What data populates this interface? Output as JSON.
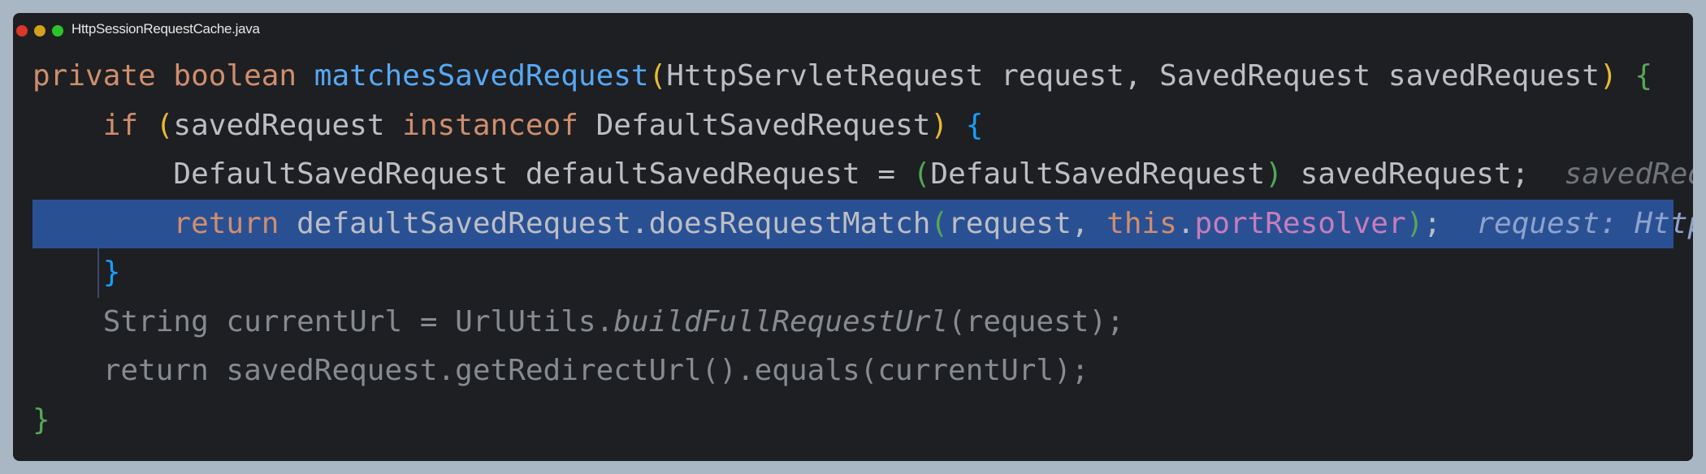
{
  "window": {
    "title": "HttpSessionRequestCache.java",
    "traffic_lights": [
      "#d9382a",
      "#d4a020",
      "#2ac42a"
    ]
  },
  "colors": {
    "keyword": "#cf8e6d",
    "method": "#56a8f5",
    "text": "#bcbec4",
    "paren_yellow": "#e8ba36",
    "paren_green": "#54a857",
    "brace_blue": "#179fff",
    "field": "#c77dbb",
    "dim": "#868a91",
    "hint": "#6f737a",
    "hint_hl": "#8ea2cc",
    "highlight": "#2a5094"
  },
  "lines": [
    {
      "indent": 0,
      "tokens": [
        [
          "private ",
          "keyword"
        ],
        [
          "boolean ",
          "keyword"
        ],
        [
          "matchesSavedRequest",
          "method"
        ],
        [
          "(",
          "paren_yellow"
        ],
        [
          "HttpServletRequest request, SavedRequest savedRequest",
          "text"
        ],
        [
          ")",
          "paren_yellow"
        ],
        [
          " ",
          "text"
        ],
        [
          "{",
          "paren_green"
        ]
      ]
    },
    {
      "indent": 1,
      "tokens": [
        [
          "if ",
          "keyword"
        ],
        [
          "(",
          "paren_yellow"
        ],
        [
          "savedRequest ",
          "text"
        ],
        [
          "instanceof ",
          "keyword"
        ],
        [
          "DefaultSavedRequest",
          "text"
        ],
        [
          ")",
          "paren_yellow"
        ],
        [
          " ",
          "text"
        ],
        [
          "{",
          "brace_blue"
        ]
      ]
    },
    {
      "indent": 2,
      "tokens": [
        [
          "DefaultSavedRequest defaultSavedRequest = ",
          "text"
        ],
        [
          "(",
          "paren_green"
        ],
        [
          "DefaultSavedRequest",
          "text"
        ],
        [
          ")",
          "paren_green"
        ],
        [
          " savedRequest;  ",
          "text"
        ],
        [
          "savedRequest: DefaultSavedRequest",
          "hint"
        ]
      ]
    },
    {
      "indent": 2,
      "highlight": true,
      "tokens": [
        [
          "return ",
          "keyword"
        ],
        [
          "defaultSavedRequest.doesRequestMatch",
          "text"
        ],
        [
          "(",
          "paren_green"
        ],
        [
          "request, ",
          "text"
        ],
        [
          "this",
          "keyword"
        ],
        [
          ".",
          "text"
        ],
        [
          "portResolver",
          "field"
        ],
        [
          ")",
          "paren_green"
        ],
        [
          ";  ",
          "text"
        ],
        [
          "request: HttpServletRequest",
          "hint_hl"
        ]
      ]
    },
    {
      "indent": 1,
      "tokens": [
        [
          "}",
          "brace_blue"
        ]
      ]
    },
    {
      "indent": 1,
      "tokens": [
        [
          "String currentUrl = UrlUtils.",
          "dim"
        ],
        [
          "buildFullRequestUrl",
          "dim_italic"
        ],
        [
          "(request);",
          "dim"
        ]
      ]
    },
    {
      "indent": 1,
      "tokens": [
        [
          "return savedRequest.getRedirectUrl().equals(currentUrl);",
          "dim"
        ]
      ]
    },
    {
      "indent": 0,
      "tokens": [
        [
          "}",
          "paren_green"
        ]
      ]
    }
  ]
}
